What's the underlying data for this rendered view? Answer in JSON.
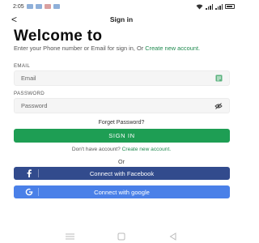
{
  "status_bar": {
    "time": "2:05"
  },
  "nav": {
    "back": "<",
    "title": "Sign in"
  },
  "headline": "Welcome to",
  "subtitle": {
    "line": "Enter your Phone number or Email for sign in, Or ",
    "link": "Create new account."
  },
  "email": {
    "label": "EMAIL",
    "placeholder": "Email",
    "icon": "contact-card-icon"
  },
  "password": {
    "label": "PASSWORD",
    "placeholder": "Password",
    "icon": "eye-off-icon"
  },
  "forgot": "Forget Password?",
  "signin": "SIGN IN",
  "no_account": {
    "text": "Don't have account? ",
    "link": "Create new account."
  },
  "or": "Or",
  "facebook": {
    "label": "Connect with Facebook",
    "icon": "facebook-icon"
  },
  "google": {
    "label": "Connect with google",
    "icon": "google-icon"
  },
  "colors": {
    "primary": "#1e9e54",
    "link": "#1f8a4f",
    "facebook": "#324b8d",
    "google": "#4a80e8",
    "field_bg": "#f5f5f5"
  }
}
